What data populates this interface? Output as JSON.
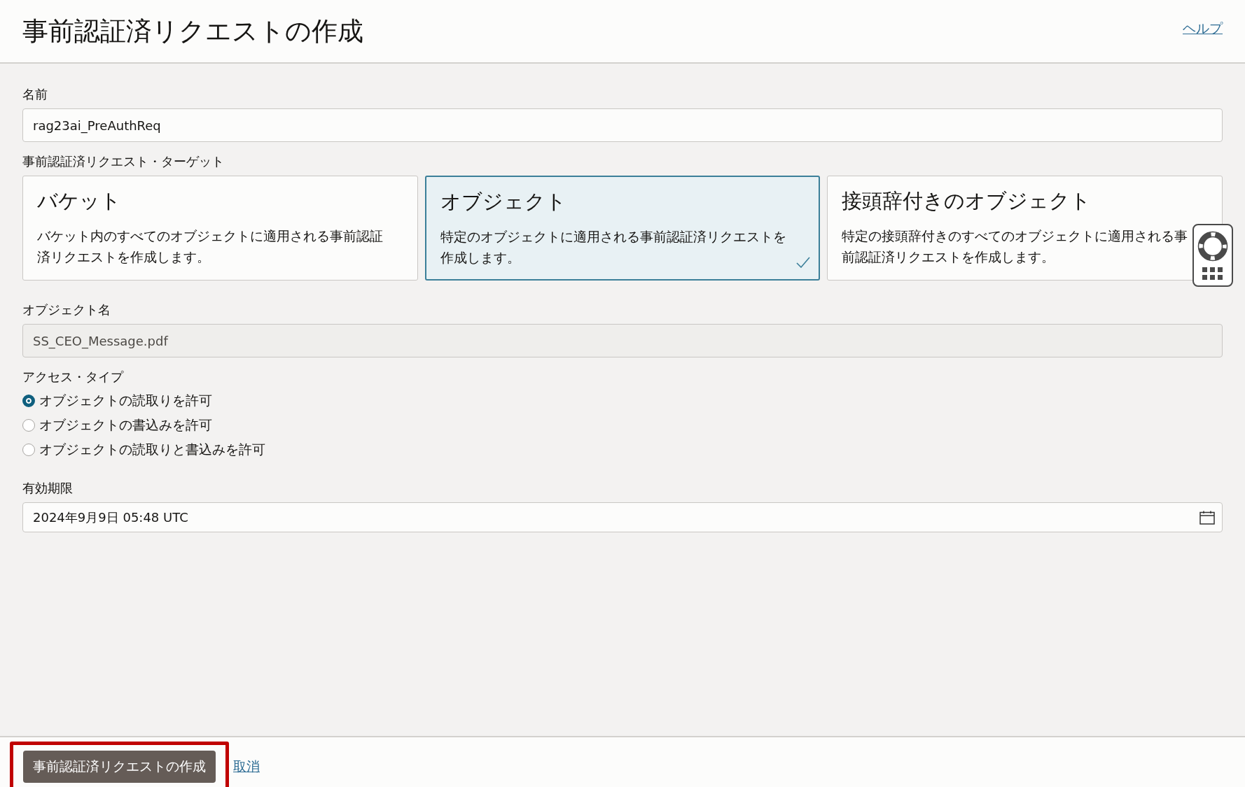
{
  "header": {
    "title": "事前認証済リクエストの作成",
    "help_link": "ヘルプ"
  },
  "name_field": {
    "label": "名前",
    "value": "rag23ai_PreAuthReq"
  },
  "target": {
    "label": "事前認証済リクエスト・ターゲット",
    "options": [
      {
        "title": "バケット",
        "description": "バケット内のすべてのオブジェクトに適用される事前認証済リクエストを作成します。",
        "selected": false
      },
      {
        "title": "オブジェクト",
        "description": "特定のオブジェクトに適用される事前認証済リクエストを作成します。",
        "selected": true
      },
      {
        "title": "接頭辞付きのオブジェクト",
        "description": "特定の接頭辞付きのすべてのオブジェクトに適用される事前認証済リクエストを作成します。",
        "selected": false
      }
    ]
  },
  "object_name_field": {
    "label": "オブジェクト名",
    "value": "SS_CEO_Message.pdf",
    "disabled": true
  },
  "access_type": {
    "label": "アクセス・タイプ",
    "options": [
      {
        "label": "オブジェクトの読取りを許可",
        "selected": true
      },
      {
        "label": "オブジェクトの書込みを許可",
        "selected": false
      },
      {
        "label": "オブジェクトの読取りと書込みを許可",
        "selected": false
      }
    ]
  },
  "expiration_field": {
    "label": "有効期限",
    "value": "2024年9月9日 05:48 UTC"
  },
  "footer": {
    "submit_button": {
      "label": "事前認証済リクエストの作成",
      "highlighted": true
    },
    "cancel_link": "取消"
  }
}
